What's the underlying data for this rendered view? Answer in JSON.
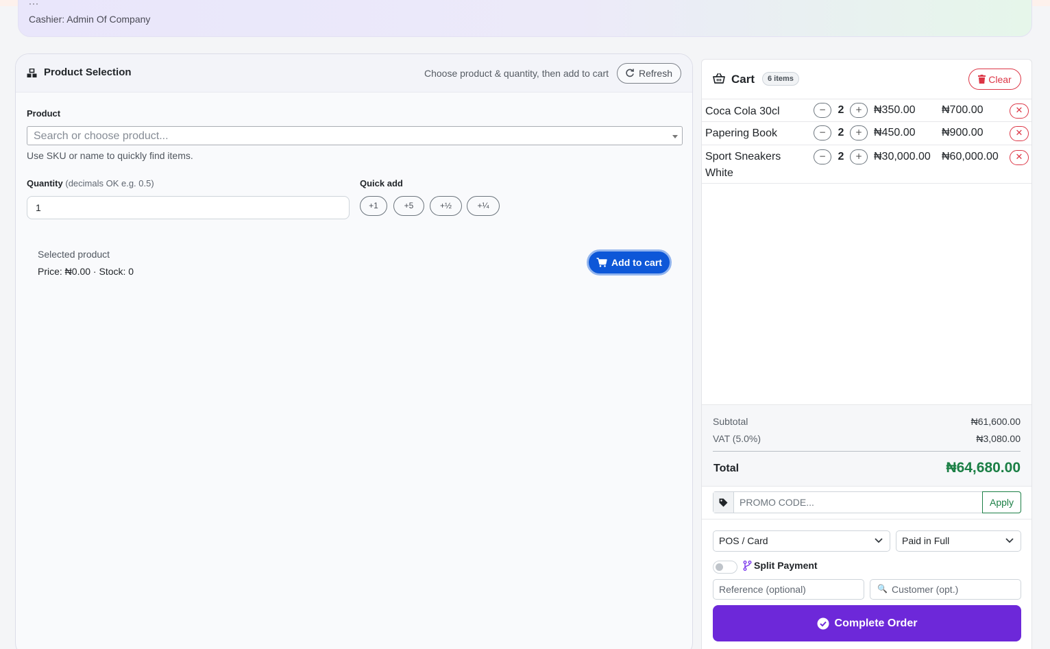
{
  "header": {
    "cashier_text": "Cashier: Admin Of Company"
  },
  "product_selection": {
    "title": "Product Selection",
    "hint": "Choose product & quantity, then add to cart",
    "refresh_label": "Refresh",
    "product_label": "Product",
    "product_placeholder": "Search or choose product...",
    "product_help": "Use SKU or name to quickly find items.",
    "quantity_label": "Quantity",
    "quantity_note": "(decimals OK e.g. 0.5)",
    "quantity_value": "1",
    "quick_add_label": "Quick add",
    "quick_add": [
      "+1",
      "+5",
      "+½",
      "+¼"
    ],
    "selected_label": "Selected product",
    "selected_info": "Price: ₦0.00 · Stock: 0",
    "add_to_cart_label": "Add to cart"
  },
  "cart": {
    "title": "Cart",
    "badge": "6 items",
    "clear_label": "Clear",
    "items": [
      {
        "name": "Coca Cola 30cl",
        "qty": "2",
        "price": "₦350.00",
        "total": "₦700.00"
      },
      {
        "name": "Papering Book",
        "qty": "2",
        "price": "₦450.00",
        "total": "₦900.00"
      },
      {
        "name": "Sport Sneakers White",
        "qty": "2",
        "price": "₦30,000.00",
        "total": "₦60,000.00"
      }
    ],
    "subtotal_label": "Subtotal",
    "subtotal_value": "₦61,600.00",
    "vat_label": "VAT (5.0%)",
    "vat_value": "₦3,080.00",
    "total_label": "Total",
    "total_value": "₦64,680.00",
    "promo_placeholder": "PROMO CODE...",
    "apply_label": "Apply",
    "payment_method": "POS / Card",
    "payment_status": "Paid in Full",
    "split_payment_label": "Split Payment",
    "reference_placeholder": "Reference (optional)",
    "customer_placeholder": "Customer (opt.)",
    "complete_label": "Complete Order"
  },
  "colors": {
    "primary_blue": "#0d57d8",
    "danger": "#dc3545",
    "success": "#1b7f45",
    "purple": "#6d28d9"
  }
}
